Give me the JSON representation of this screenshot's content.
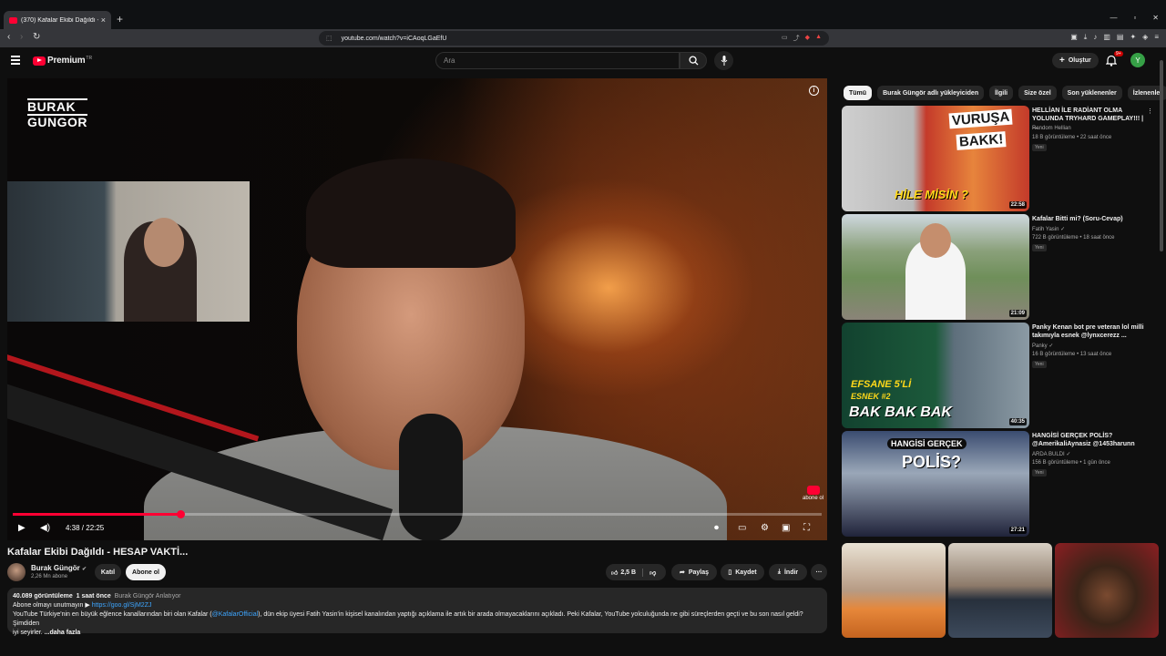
{
  "browser": {
    "tab_title": "(370) Kafalar Ekibi Dağıldı - HESA",
    "tab_close": "×",
    "new_tab": "+",
    "url": "youtube.com/watch?v=iCAoqLGaEfU"
  },
  "header": {
    "logo_text": "Premium",
    "logo_tm": "TR",
    "search_placeholder": "Ara",
    "create_label": "Oluştur",
    "notification_count": "9+",
    "avatar_letter": "Y"
  },
  "player": {
    "watermark_line1": "BURAK",
    "watermark_line2": "GUNGOR",
    "time": "4:38 / 22:25",
    "progress": 0.207,
    "abone_watermark": "abone ol"
  },
  "video": {
    "title": "Kafalar Ekibi Dağıldı - HESAP VAKTİ...",
    "channel": "Burak Güngör",
    "subscribers": "2,26 Mn abone",
    "join_label": "Katıl",
    "subscribe_label": "Abone ol",
    "likes": "2,5 B",
    "share_label": "Paylaş",
    "save_label": "Kaydet",
    "download_label": "İndir",
    "more_label": "···"
  },
  "description": {
    "views": "40.089 görüntüleme",
    "age": "1 saat önce",
    "tagline": "Burak Güngör Anlatıyor",
    "line2_prefix": "Abone olmayı unutmayın ▶",
    "line2_link": "https://goo.gl/SjM2ZJ",
    "line3_start": "YouTube Türkiye'nin en büyük eğlence kanallarından biri olan Kafalar (",
    "line3_mention": "@KafalarOfficial",
    "line3_end": "), dün ekip üyesi Fatih Yasin'in kişisel kanalından yaptığı açıklama ile artık bir arada olmayacaklarını açıkladı. Peki Kafalar, YouTube yolculuğunda ne gibi süreçlerden geçti ve bu son nasıl geldi? Şimdiden",
    "line4": "iyi seyirler.",
    "more": "...daha fazla"
  },
  "sidebar": {
    "chips": [
      "Tümü",
      "Burak Güngör adlı yükleyiciden",
      "İlgili",
      "Size özel",
      "Son yüklenenler",
      "İzlenenler"
    ],
    "recommendations": [
      {
        "title": "HELLİAN İLE RADİANT OLMA YOLUNDA TRYHARD GAMEPLAY!!! | ...",
        "channel": "Random Hellian",
        "meta": "18 B görüntüleme • 22 saat önce",
        "badge": "Yeni",
        "duration": "22:58",
        "thumb_text1": "VURUŞA",
        "thumb_text2": "BAKK!",
        "thumb_text3": "HİLE MİSİN ?"
      },
      {
        "title": "Kafalar Bitti mi? (Soru-Cevap)",
        "channel": "Fatih Yasin ✓",
        "meta": "722 B görüntüleme • 18 saat önce",
        "badge": "Yeni",
        "duration": "21:09"
      },
      {
        "title": "Panky Kenan bot pre veteran lol milli takımıyla esnek @lynxcerezz ...",
        "channel": "Panky ✓",
        "meta": "16 B görüntüleme • 13 saat önce",
        "badge": "Yeni",
        "duration": "40:35",
        "thumb_text1": "EFSANE 5'Lİ",
        "thumb_text2": "ESNEK #2",
        "thumb_text3": "BAK BAK BAK"
      },
      {
        "title": "HANGİSİ GERÇEK POLİS? @AmerikaliAynasiz @1453harunn",
        "channel": "ARDA BULDI ✓",
        "meta": "156 B görüntüleme • 1 gün önce",
        "badge": "Yeni",
        "duration": "27:21",
        "thumb_text1": "HANGİSİ GERÇEK",
        "thumb_text2": "POLİS?"
      }
    ]
  },
  "colors": {
    "background": "#0f0f0f",
    "accent_red": "#ff0033",
    "link_blue": "#3ea6ff",
    "chip_bg": "#272727"
  }
}
